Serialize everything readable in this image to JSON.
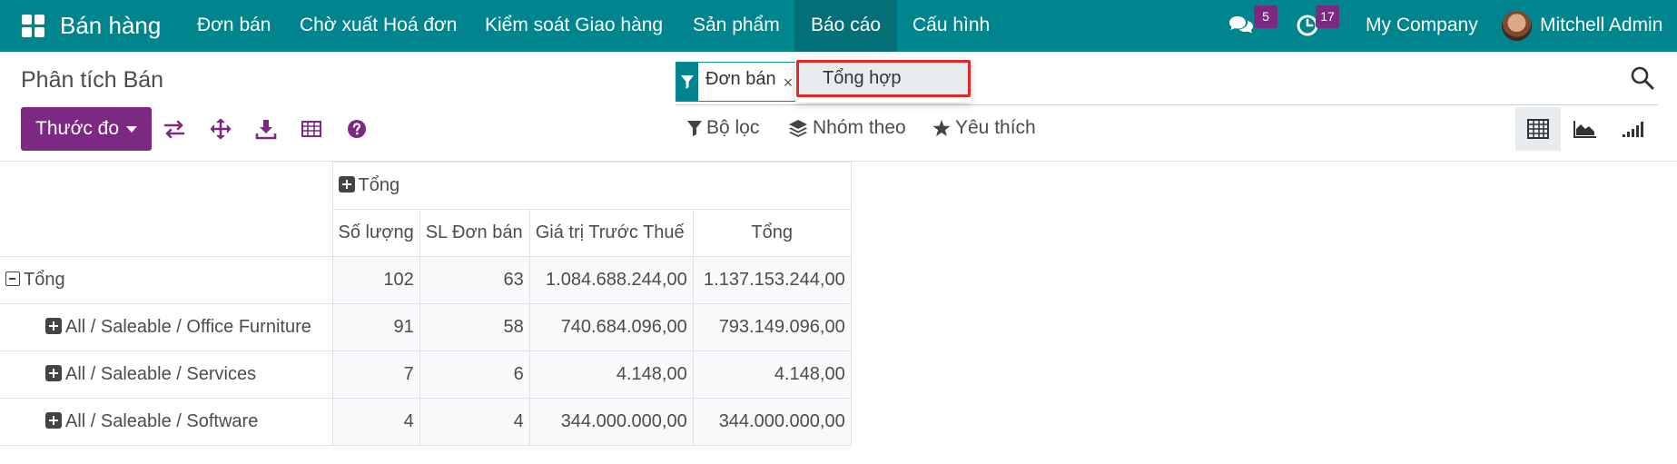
{
  "topbar": {
    "app_name": "Bán hàng",
    "menu": [
      "Đơn bán",
      "Chờ xuất Hoá đơn",
      "Kiểm soát Giao hàng",
      "Sản phẩm",
      "Báo cáo",
      "Cấu hình"
    ],
    "active_menu": "Báo cáo",
    "messages_count": "5",
    "activities_count": "17",
    "company": "My Company",
    "user": "Mitchell Admin"
  },
  "control_panel": {
    "title": "Phân tích Bán",
    "search_facet": "Đơn bán",
    "facet_remove": "×",
    "dropdown_item": "Tổng hợp",
    "measures_label": "Thước đo",
    "filters_label": "Bộ lọc",
    "group_by_label": "Nhóm theo",
    "favorites_label": "Yêu thích"
  },
  "pivot": {
    "col_group_header": "Tổng",
    "measure_headers": [
      "Số lượng",
      "SL Đơn bán",
      "Giá trị Trước Thuế",
      "Tổng"
    ],
    "total_row": {
      "label": "Tổng",
      "values": [
        "102",
        "63",
        "1.084.688.244,00",
        "1.137.153.244,00"
      ]
    },
    "rows": [
      {
        "label": "All / Saleable / Office Furniture",
        "values": [
          "91",
          "58",
          "740.684.096,00",
          "793.149.096,00"
        ]
      },
      {
        "label": "All / Saleable / Services",
        "values": [
          "7",
          "6",
          "4.148,00",
          "4.148,00"
        ]
      },
      {
        "label": "All / Saleable / Software",
        "values": [
          "4",
          "4",
          "344.000.000,00",
          "344.000.000,00"
        ]
      }
    ]
  },
  "colors": {
    "brand": "#00848d",
    "primary_button": "#7c2984",
    "highlight_border": "#e02a2a"
  }
}
